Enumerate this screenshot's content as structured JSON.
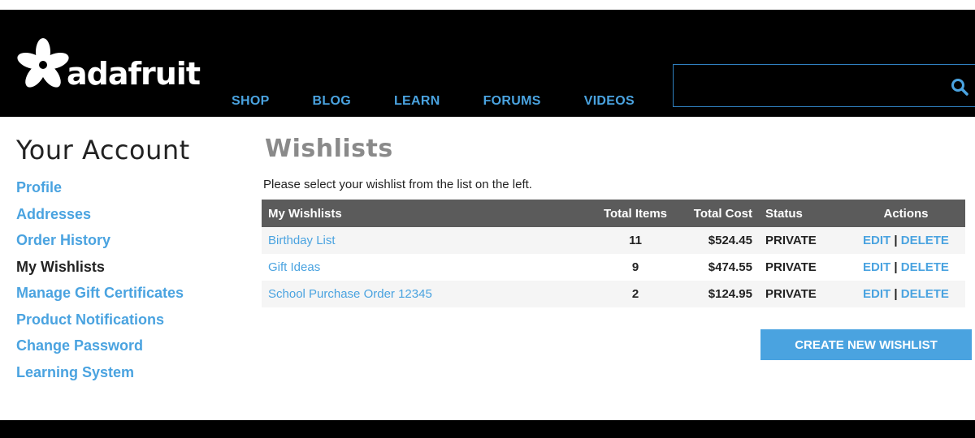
{
  "header": {
    "logo_text": "adafruit",
    "nav": [
      "SHOP",
      "BLOG",
      "LEARN",
      "FORUMS",
      "VIDEOS"
    ],
    "search": {
      "value": "",
      "placeholder": ""
    }
  },
  "sidebar": {
    "title": "Your Account",
    "items": [
      {
        "label": "Profile"
      },
      {
        "label": "Addresses"
      },
      {
        "label": "Order History"
      },
      {
        "label": "My Wishlists"
      },
      {
        "label": "Manage Gift Certificates"
      },
      {
        "label": "Product Notifications"
      },
      {
        "label": "Change Password"
      },
      {
        "label": "Learning System"
      }
    ],
    "active_index": 3
  },
  "main": {
    "title": "Wishlists",
    "intro": "Please select your wishlist from the list on the left.",
    "table": {
      "headers": {
        "name": "My Wishlists",
        "items": "Total Items",
        "cost": "Total Cost",
        "status": "Status",
        "actions": "Actions"
      },
      "rows": [
        {
          "name": "Birthday List",
          "items": "11",
          "cost": "$524.45",
          "status": "PRIVATE",
          "edit": "EDIT",
          "sep": "|",
          "delete": "DELETE"
        },
        {
          "name": "Gift Ideas",
          "items": "9",
          "cost": "$474.55",
          "status": "PRIVATE",
          "edit": "EDIT",
          "sep": "|",
          "delete": "DELETE"
        },
        {
          "name": "School Purchase Order 12345",
          "items": "2",
          "cost": "$124.95",
          "status": "PRIVATE",
          "edit": "EDIT",
          "sep": "|",
          "delete": "DELETE"
        }
      ]
    },
    "create_button": "CREATE NEW WISHLIST"
  },
  "colors": {
    "accent": "#4aa3e0",
    "header_bg": "#000000",
    "table_header_bg": "#5b5b5b"
  },
  "icons": {
    "logo": "adafruit-flower-logo",
    "search": "search-icon"
  }
}
